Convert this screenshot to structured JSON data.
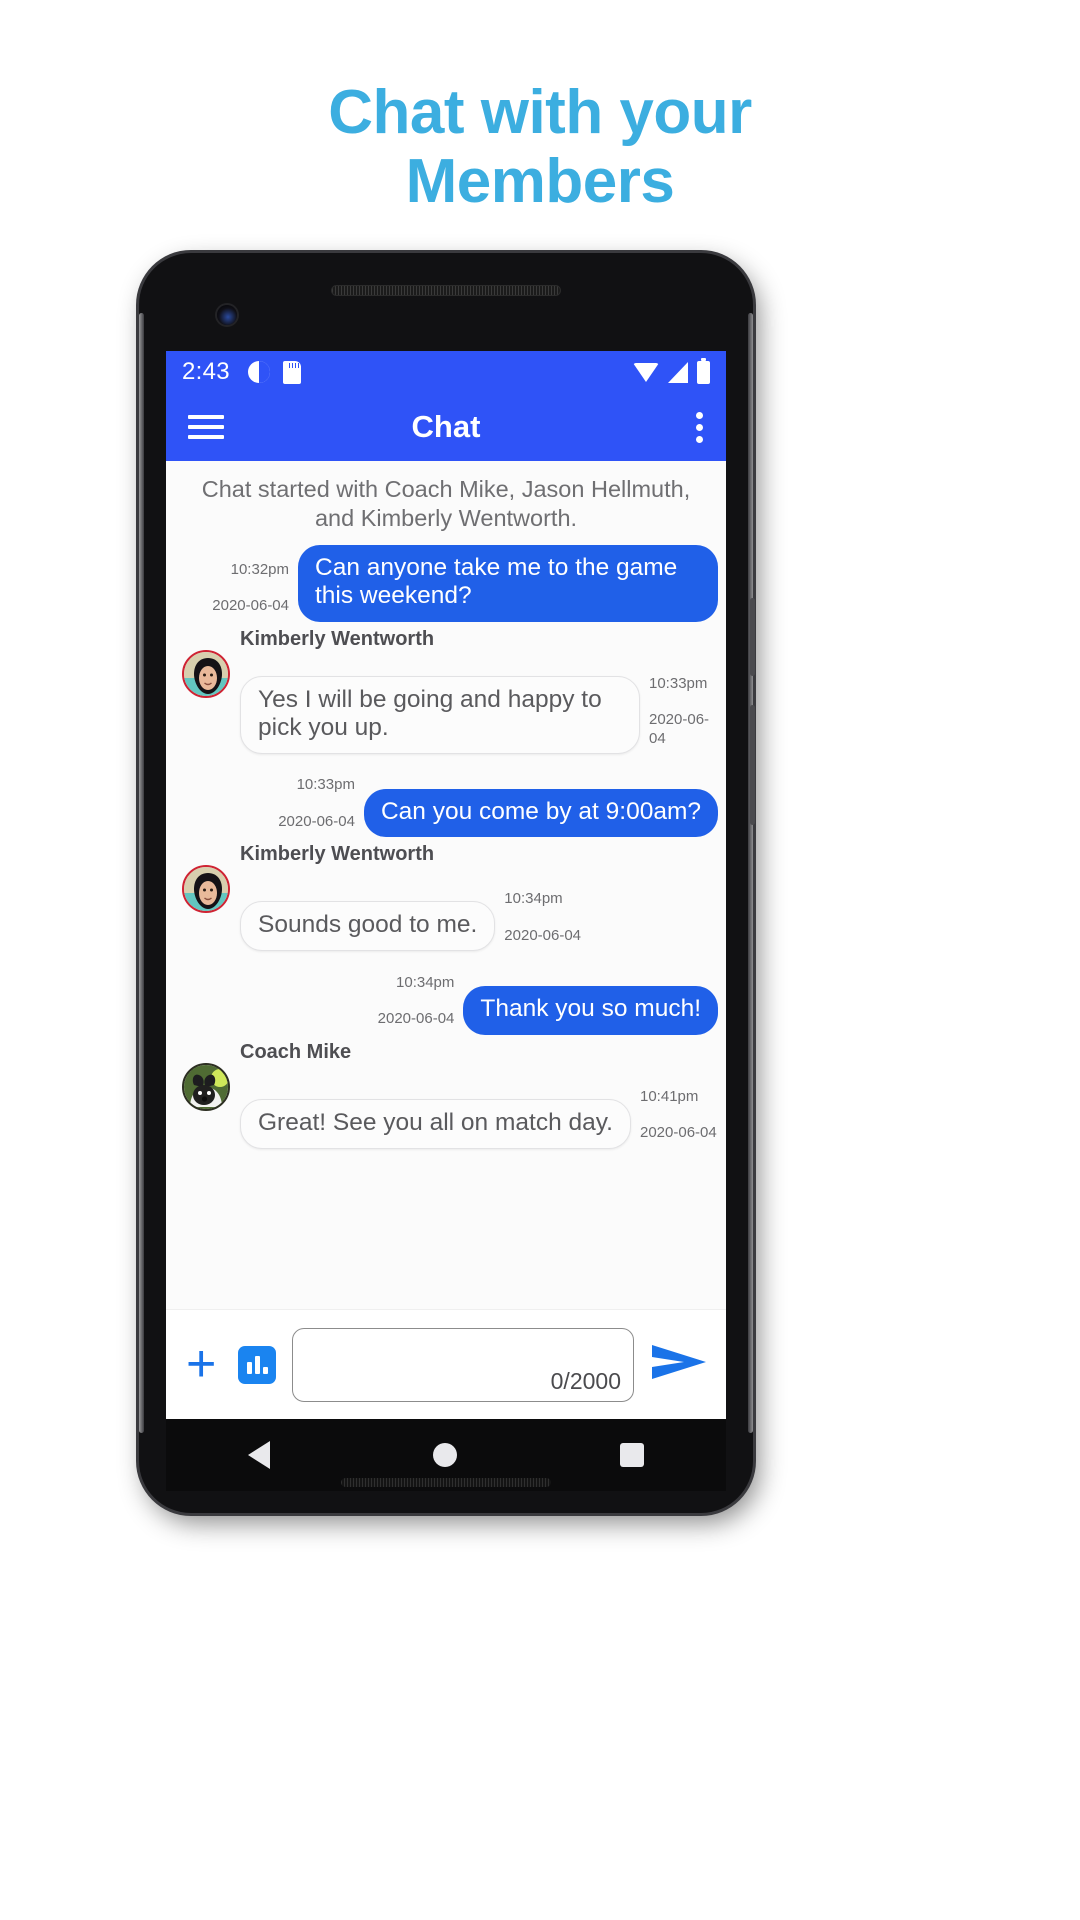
{
  "headline": {
    "line1": "Chat with your",
    "line2": "Members",
    "color": "#3caee0"
  },
  "status_bar": {
    "time": "2:43",
    "left_icons": [
      "do-not-disturb-icon",
      "sd-card-icon"
    ],
    "right_icons": [
      "wifi-icon",
      "cellular-signal-icon",
      "battery-icon"
    ],
    "background": "#2f53f7"
  },
  "app_bar": {
    "menu_icon": "hamburger-menu-icon",
    "title": "Chat",
    "overflow_icon": "kebab-menu-icon",
    "background": "#2f53f7"
  },
  "chat": {
    "started_notice": "Chat started with Coach Mike, Jason Hellmuth, and Kimberly Wentworth.",
    "outgoing_color": "#2060e8",
    "messages": [
      {
        "direction": "outgoing",
        "text": "Can anyone take me to the game this weekend?",
        "time": "10:32pm",
        "date": "2020-06-04"
      },
      {
        "direction": "incoming",
        "sender": "Kimberly Wentworth",
        "avatar": "kimberly-avatar",
        "text": "Yes I will be going and happy to pick you up.",
        "time": "10:33pm",
        "date": "2020-06-04"
      },
      {
        "direction": "outgoing",
        "text": "Can you come by at 9:00am?",
        "time": "10:33pm",
        "date": "2020-06-04"
      },
      {
        "direction": "incoming",
        "sender": "Kimberly Wentworth",
        "avatar": "kimberly-avatar",
        "text": "Sounds good to me.",
        "time": "10:34pm",
        "date": "2020-06-04"
      },
      {
        "direction": "outgoing",
        "text": "Thank you so much!",
        "time": "10:34pm",
        "date": "2020-06-04"
      },
      {
        "direction": "incoming",
        "sender": "Coach Mike",
        "avatar": "coach-mike-avatar",
        "text": "Great! See you all on match day.",
        "time": "10:41pm",
        "date": "2020-06-04"
      }
    ]
  },
  "composer": {
    "attach_icon": "plus-icon",
    "poll_icon": "poll-chart-icon",
    "input_value": "",
    "input_placeholder": "",
    "char_counter": "0/2000",
    "send_icon": "send-arrow-icon"
  },
  "nav_bar": {
    "back": "back-triangle-icon",
    "home": "home-circle-icon",
    "recents": "recents-square-icon"
  }
}
